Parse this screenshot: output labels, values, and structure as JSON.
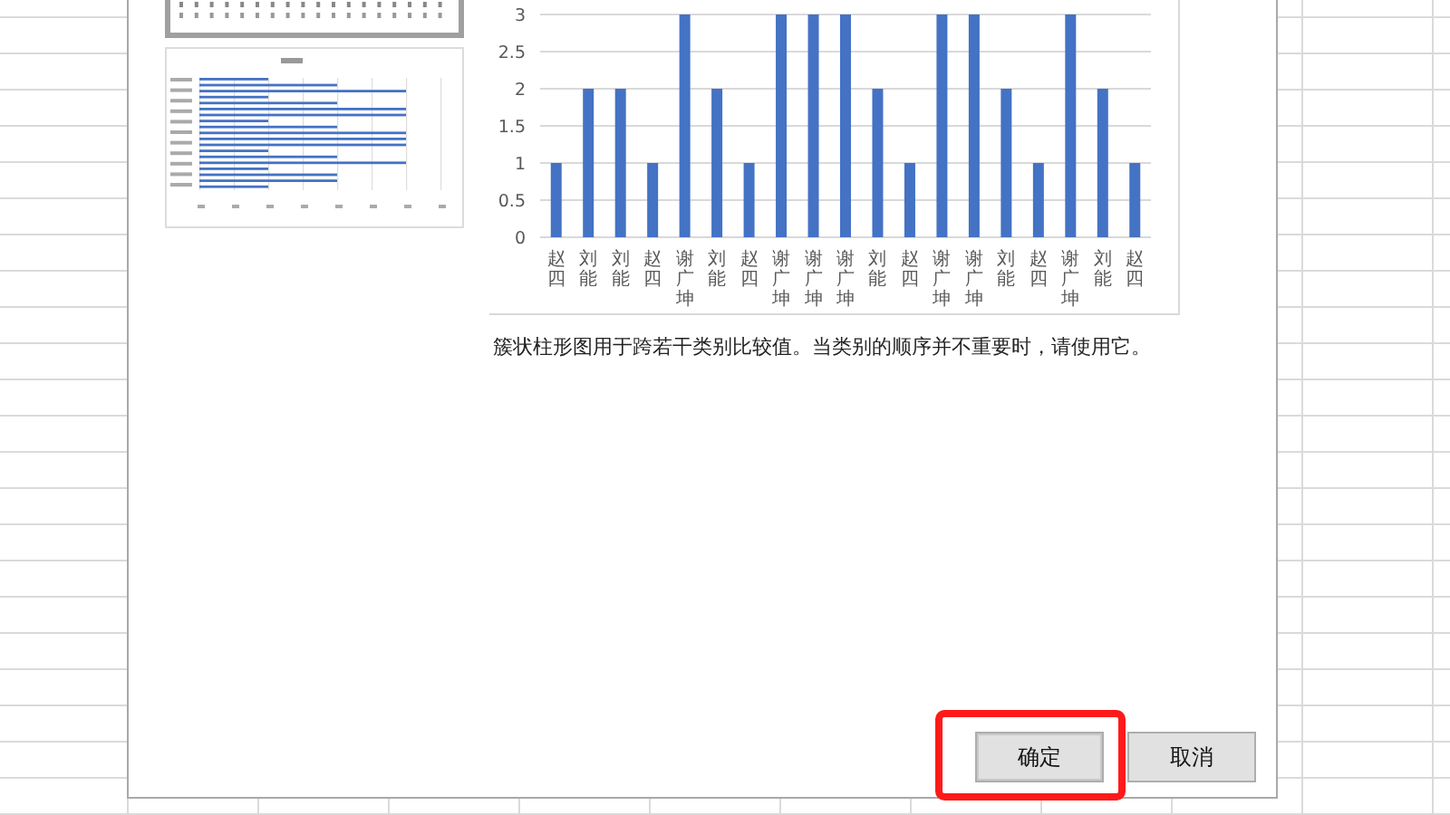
{
  "thumbnails": [
    {
      "kind": "column",
      "selected": true
    },
    {
      "kind": "bar",
      "selected": false
    }
  ],
  "chart_data": {
    "type": "bar",
    "categories": [
      "赵四",
      "刘能",
      "刘能",
      "赵四",
      "谢广坤",
      "刘能",
      "赵四",
      "谢广坤",
      "谢广坤",
      "谢广坤",
      "刘能",
      "赵四",
      "谢广坤",
      "谢广坤",
      "刘能",
      "赵四",
      "谢广坤",
      "刘能",
      "赵四"
    ],
    "series": [
      {
        "color": "#4472c4",
        "values": [
          1,
          2,
          2,
          1,
          3,
          2,
          1,
          3,
          3,
          3,
          2,
          1,
          3,
          3,
          2,
          1,
          3,
          2,
          1
        ]
      }
    ],
    "ylim": [
      0,
      3
    ],
    "yticks": [
      0,
      0.5,
      1,
      1.5,
      2,
      2.5,
      3
    ],
    "grid": true
  },
  "description": "簇状柱形图用于跨若干类别比较值。当类别的顺序并不重要时，请使用它。",
  "buttons": [
    {
      "label": "确定",
      "highlighted": true
    },
    {
      "label": "取消",
      "highlighted": false
    }
  ]
}
